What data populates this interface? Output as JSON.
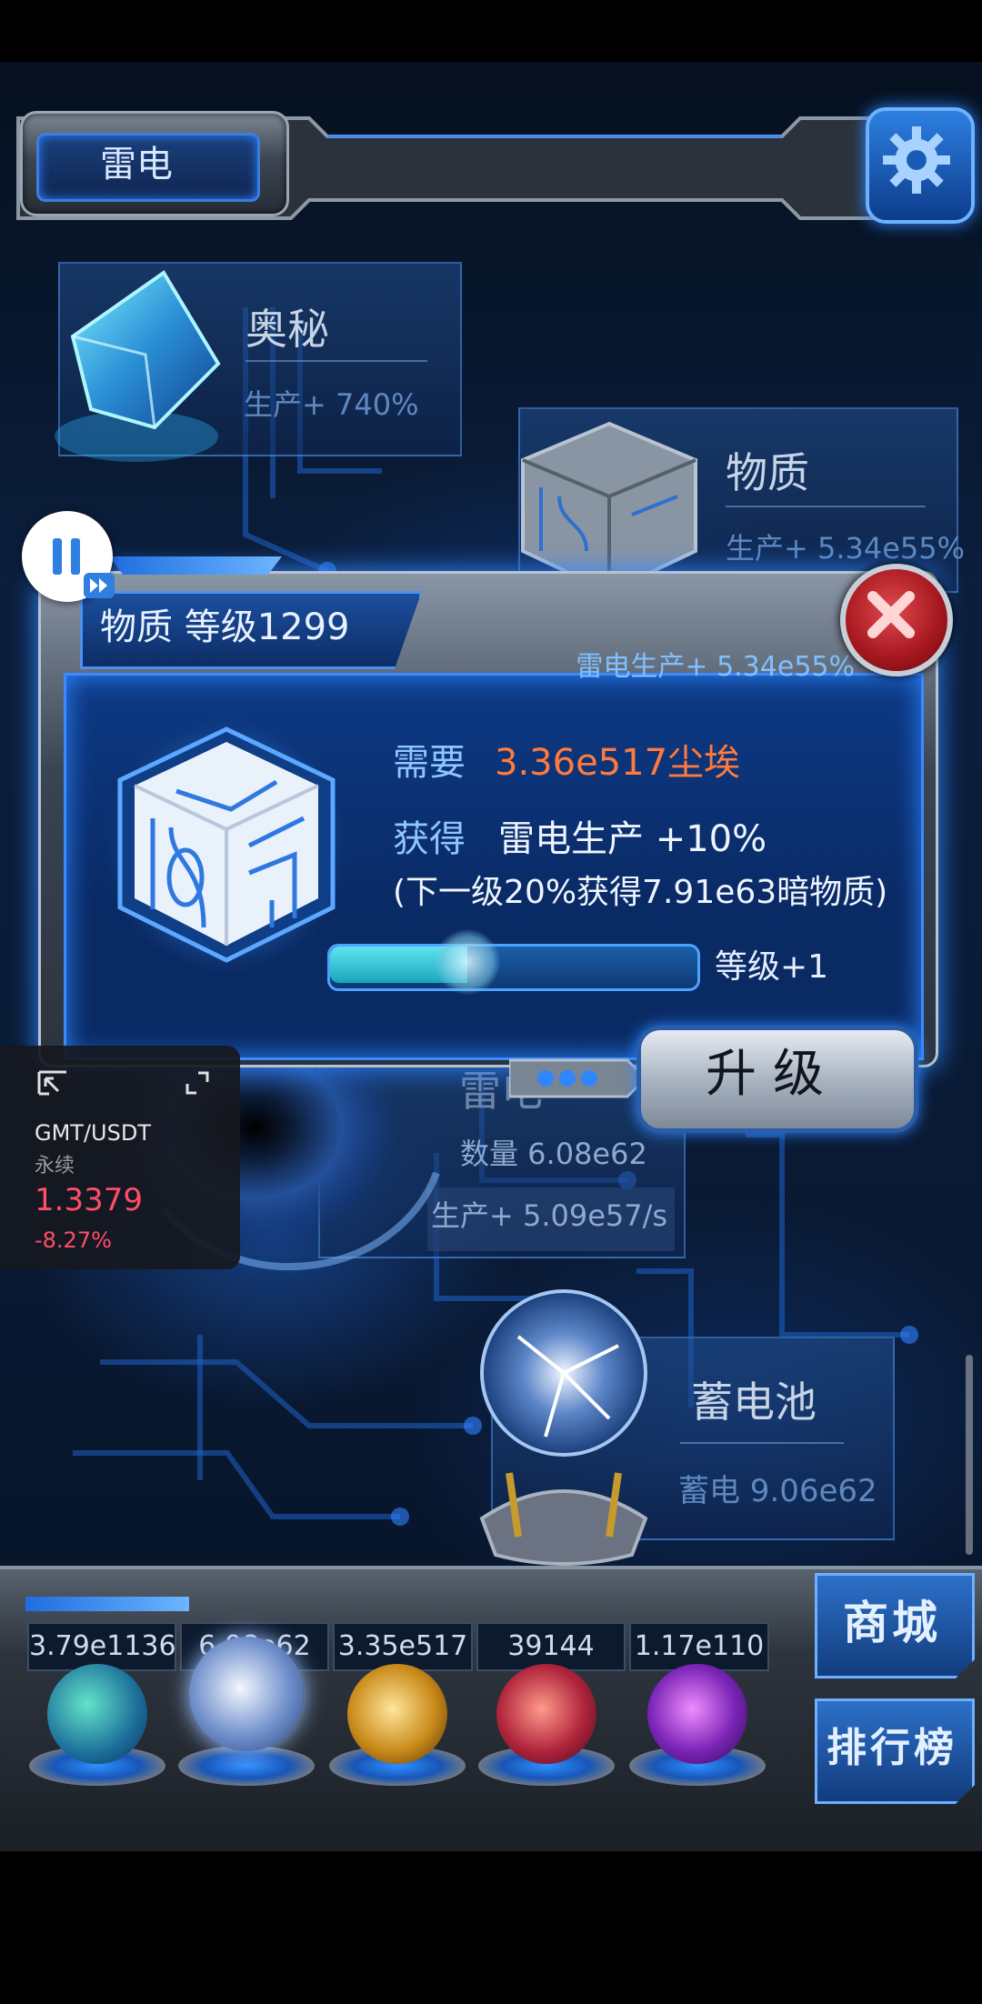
{
  "header": {
    "region_title": "雷电"
  },
  "cards": {
    "arcane": {
      "title": "奥秘",
      "production": "生产+ 740%"
    },
    "matter": {
      "title": "物质",
      "production": "生产+ 5.34e55%"
    },
    "thunder": {
      "title_partial": "雷电",
      "amount": "数量 6.08e62",
      "production": "生产+ 5.09e57/s"
    },
    "battery": {
      "title": "蓄电池",
      "charge": "蓄电 9.06e62"
    }
  },
  "dialog": {
    "title": "物质 等级1299",
    "production": "雷电生产+ 5.34e55%",
    "need_label": "需要",
    "need_value": "3.36e517尘埃",
    "gain_label": "获得",
    "gain_value": "雷电生产 +10%",
    "note": "(下一级20%获得7.91e63暗物质)",
    "progress_fraction": 0.38,
    "level_step": "等级+1",
    "upgrade_label": "升级"
  },
  "ticker": {
    "symbol": "GMT/USDT",
    "type": "永续",
    "price": "1.3379",
    "change": "-8.27%"
  },
  "resources": [
    "3.79e1136",
    "6.08e62",
    "3.35e517",
    "39144",
    "1.17e110"
  ],
  "side_buttons": {
    "shop": "商城",
    "ranking": "排行榜"
  },
  "colors": {
    "accent": "#2f86ff",
    "cost": "#ff7a3b",
    "ticker_down": "#ff4d6a"
  }
}
